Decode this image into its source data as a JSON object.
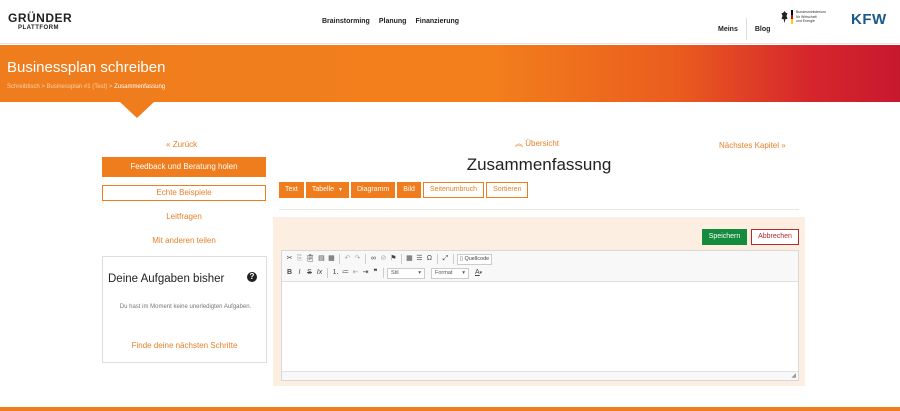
{
  "brand": {
    "line1": "GRÜNDER",
    "line2": "PLATTFORM",
    "accent": "#f07d1d"
  },
  "nav": {
    "items": [
      "Brainstorming",
      "Planung",
      "Finanzierung"
    ]
  },
  "user_nav": {
    "meins": "Meins",
    "blog": "Blog"
  },
  "sponsor": {
    "ministry_lines": [
      "Bundesministerium",
      "für Wirtschaft",
      "und Energie"
    ],
    "kfw": "KFW"
  },
  "banner": {
    "title": "Businessplan schreiben",
    "breadcrumb": [
      "Schreibtisch",
      "Businessplan #1 (Test)",
      "Zusammenfassung"
    ],
    "separator": ">"
  },
  "chapter_nav": {
    "back": "Zurück",
    "overview": "Übersicht",
    "next": "Nächstes Kapitel"
  },
  "sidebar": {
    "feedback_button": "Feedback und Beratung holen",
    "examples_button": "Echte Beispiele",
    "questions_link": "Leitfragen",
    "share_link": "Mit anderen teilen",
    "tasks": {
      "title": "Deine Aufgaben bisher",
      "help": "?",
      "empty_text": "Du hast im Moment keine unerledigten Aufgaben.",
      "next_steps": "Finde deine nächsten Schritte"
    }
  },
  "main": {
    "title": "Zusammenfassung",
    "inserts": [
      {
        "label": "Text",
        "style": "fill"
      },
      {
        "label": "Tabelle",
        "style": "fill",
        "dropdown": true
      },
      {
        "label": "Diagramm",
        "style": "fill"
      },
      {
        "label": "Bild",
        "style": "fill"
      },
      {
        "label": "Seitenumbruch",
        "style": "outline"
      },
      {
        "label": "Sortieren",
        "style": "outline"
      }
    ],
    "save": "Speichern",
    "cancel": "Abbrechen",
    "editor": {
      "source": "Quellcode",
      "style_select": "Stil",
      "format_select": "Format",
      "bold": "B",
      "italic": "I",
      "strike": "S",
      "clear": "Ix",
      "text_color": "A"
    }
  },
  "colors": {
    "save": "#148b3d",
    "cancel": "#b52a2a",
    "panel": "#fdeee2"
  }
}
